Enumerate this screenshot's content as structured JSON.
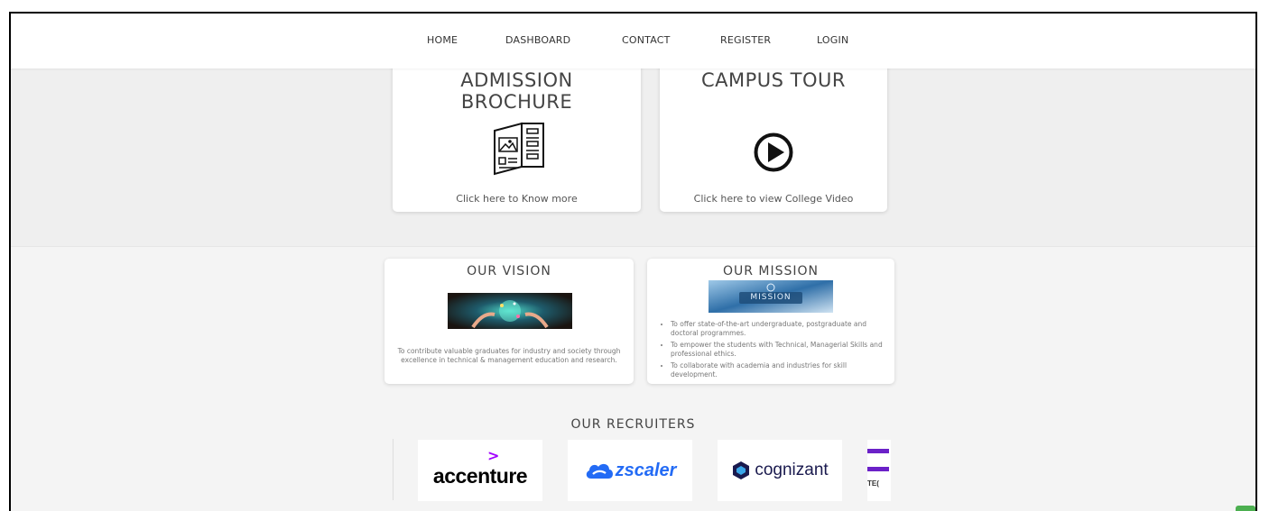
{
  "nav": {
    "items": [
      "HOME",
      "DASHBOARD",
      "CONTACT",
      "REGISTER",
      "LOGIN"
    ]
  },
  "brochure_card": {
    "title_line1": "ADMISSION",
    "title_line2": "BROCHURE",
    "link": "Click here to Know more",
    "icon": "brochure-icon"
  },
  "tour_card": {
    "title": "CAMPUS TOUR",
    "link": "Click here to view College Video",
    "icon": "play-icon"
  },
  "vision": {
    "title": "OUR VISION",
    "text": "To contribute valuable graduates for industry and society through excellence in technical & management education and research."
  },
  "mission": {
    "title": "OUR MISSION",
    "image_label": "MISSION",
    "points": [
      "To offer state-of-the-art undergraduate, postgraduate and doctoral programmes.",
      "To empower the students with Technical, Managerial Skills and professional ethics.",
      "To collaborate with academia and industries for skill development."
    ]
  },
  "recruiters": {
    "heading": "OUR RECRUITERS",
    "logos": {
      "accenture": "accenture",
      "zscaler": "zscaler",
      "cognizant": "cognizant",
      "partial": "TE("
    }
  },
  "colors": {
    "accenture_accent": "#a100ff",
    "zscaler_blue": "#236bf5",
    "cognizant_navy": "#1a1a4e",
    "partial_purple": "#6b21c8",
    "badge_green": "#4caf50"
  }
}
